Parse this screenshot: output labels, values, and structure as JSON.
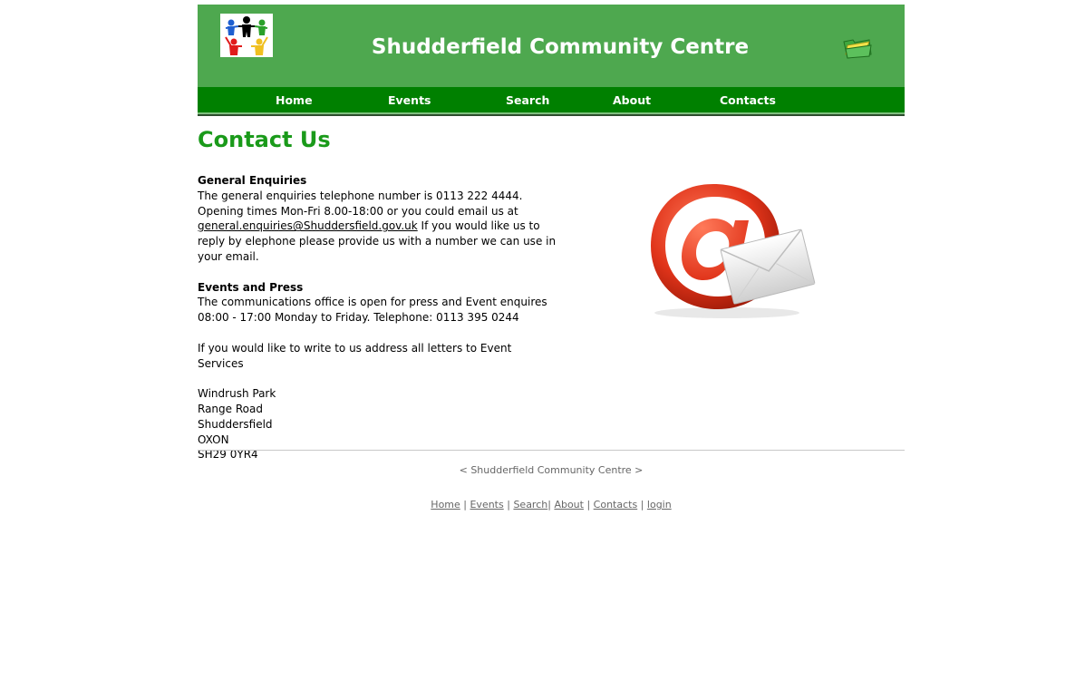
{
  "header": {
    "title": "Shudderfield Community Centre",
    "colors": {
      "banner": "#4ea84f",
      "nav": "#008000",
      "title_text": "#ffffff"
    }
  },
  "nav": {
    "items": [
      "Home",
      "Events",
      "Search",
      "About",
      "Contacts"
    ]
  },
  "main": {
    "title": "Contact Us",
    "general": {
      "heading": "General Enquiries",
      "line1": "The general enquiries telephone number is 0113 222 4444.",
      "line2": "Opening times Mon-Fri 8.00-18:00 or you could email us at",
      "email": "general.enquiries@Shuddersfield.gov.uk",
      "after_email": " If you would like us to",
      "line4": "reply by elephone please provide us with a number we can use in",
      "line5": "your email."
    },
    "press": {
      "heading": "Events and Press",
      "line1": "The communications office is open for press and Event enquires",
      "line2": "08:00 - 17:00 Monday to Friday. Telephone: 0113 395 0244"
    },
    "write_text": "If you would like to write to us address all letters to Event Services",
    "address": [
      "Windrush Park",
      "Range Road",
      "Shuddersfield",
      "OXON",
      "SH29 0YR4"
    ],
    "image_icon": "email-at-envelope-icon"
  },
  "footer": {
    "site_name": "< Shudderfield Community Centre >",
    "links": [
      "Home",
      "Events",
      "Search",
      "About",
      "Contacts",
      "login"
    ]
  }
}
